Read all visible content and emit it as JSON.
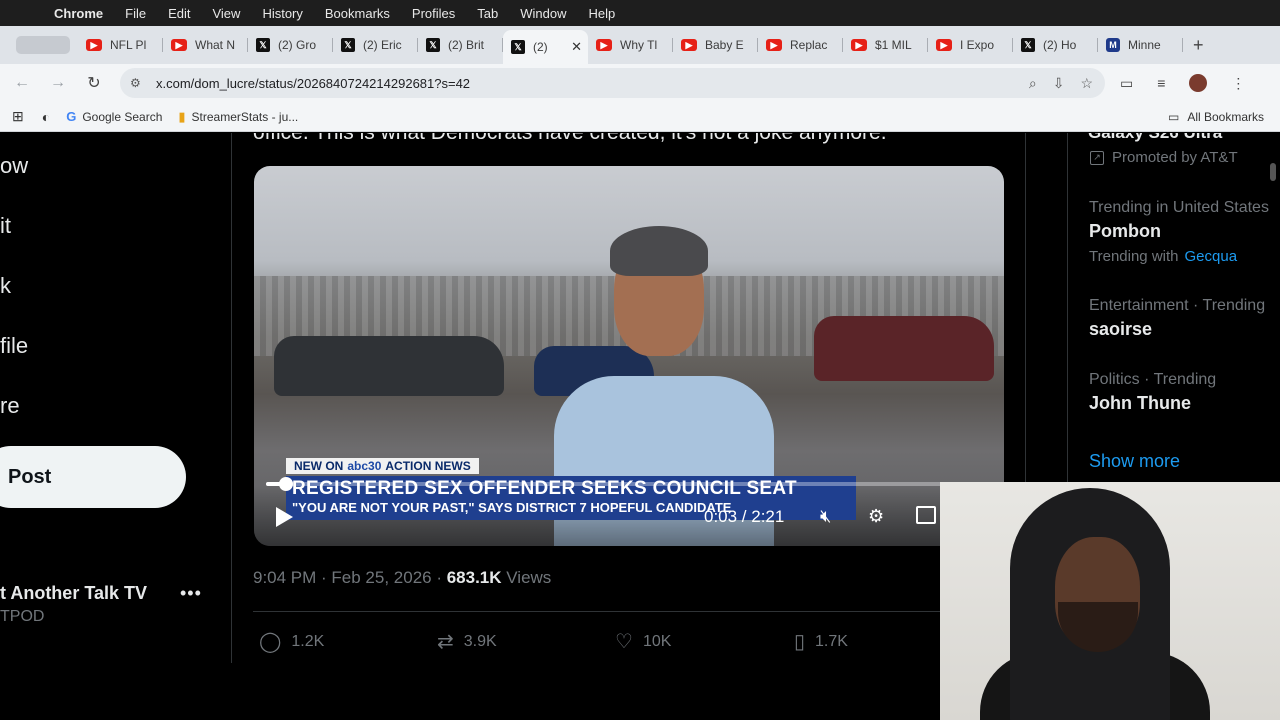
{
  "menubar": {
    "apple": "",
    "items": [
      "Chrome",
      "File",
      "Edit",
      "View",
      "History",
      "Bookmarks",
      "Profiles",
      "Tab",
      "Window",
      "Help"
    ]
  },
  "tabs": [
    {
      "label": "NFL Pl",
      "favicon": "youtube-icon"
    },
    {
      "label": "What N",
      "favicon": "youtube-icon"
    },
    {
      "label": "(2) Gro",
      "favicon": "x-icon"
    },
    {
      "label": "(2) Eric",
      "favicon": "x-icon"
    },
    {
      "label": "(2) Brit",
      "favicon": "x-icon"
    },
    {
      "label": "(2)",
      "favicon": "x-icon",
      "active": true
    },
    {
      "label": "Why Tl",
      "favicon": "youtube-icon"
    },
    {
      "label": "Baby E",
      "favicon": "youtube-icon"
    },
    {
      "label": "Replac",
      "favicon": "youtube-icon"
    },
    {
      "label": "$1 MIL",
      "favicon": "youtube-icon"
    },
    {
      "label": "I Expo",
      "favicon": "youtube-icon"
    },
    {
      "label": "(2) Ho",
      "favicon": "x-icon"
    },
    {
      "label": "Minne",
      "favicon": "minnesota-icon"
    }
  ],
  "toolbar": {
    "url": "x.com/dom_lucre/status/2026840724214292681?s=42"
  },
  "bookmarks": {
    "items": [
      "Google Search",
      "StreamerStats - ju..."
    ],
    "all": "All Bookmarks"
  },
  "leftnav": {
    "items": [
      "ow",
      "it",
      "k",
      "file",
      "re"
    ],
    "post_button": "Post",
    "account_name": "t Another Talk TV",
    "account_handle": "TPOD",
    "more": "•••"
  },
  "tweet": {
    "text_cut": "office. This is what Democrats have created, it's not a joke anymore.",
    "chyron_tag": "NEW ON",
    "chyron_logo": "abc30",
    "chyron_brand": "ACTION NEWS",
    "chyron_headline": "REGISTERED SEX OFFENDER SEEKS COUNCIL SEAT",
    "chyron_sub": "\"YOU ARE NOT YOUR PAST,\" SAYS DISTRICT 7 HOPEFUL CANDIDATE",
    "timecode": "0:03 / 2:21",
    "progress": 0.02,
    "time": "9:04 PM · Feb 25, 2026 · ",
    "views_count": "683.1K",
    "views_label": " Views",
    "replies": "1.2K",
    "reposts": "3.9K",
    "likes": "10K",
    "bookmarks": "1.7K"
  },
  "sidebar": {
    "promo_cut": "Galaxy S26 Ultra",
    "promoted": "Promoted by AT&T",
    "trends": [
      {
        "context": "Trending in United States",
        "name": "Pombon",
        "with_label": "Trending with",
        "with_link": "Gecqua"
      },
      {
        "context": "Entertainment · Trending",
        "name": "saoirse"
      },
      {
        "context": "Politics · Trending",
        "name": "John Thune"
      }
    ],
    "show_more": "Show more"
  },
  "colors": {
    "accent": "#1d9bf0",
    "chyron_blue": "#1f3f8f"
  }
}
